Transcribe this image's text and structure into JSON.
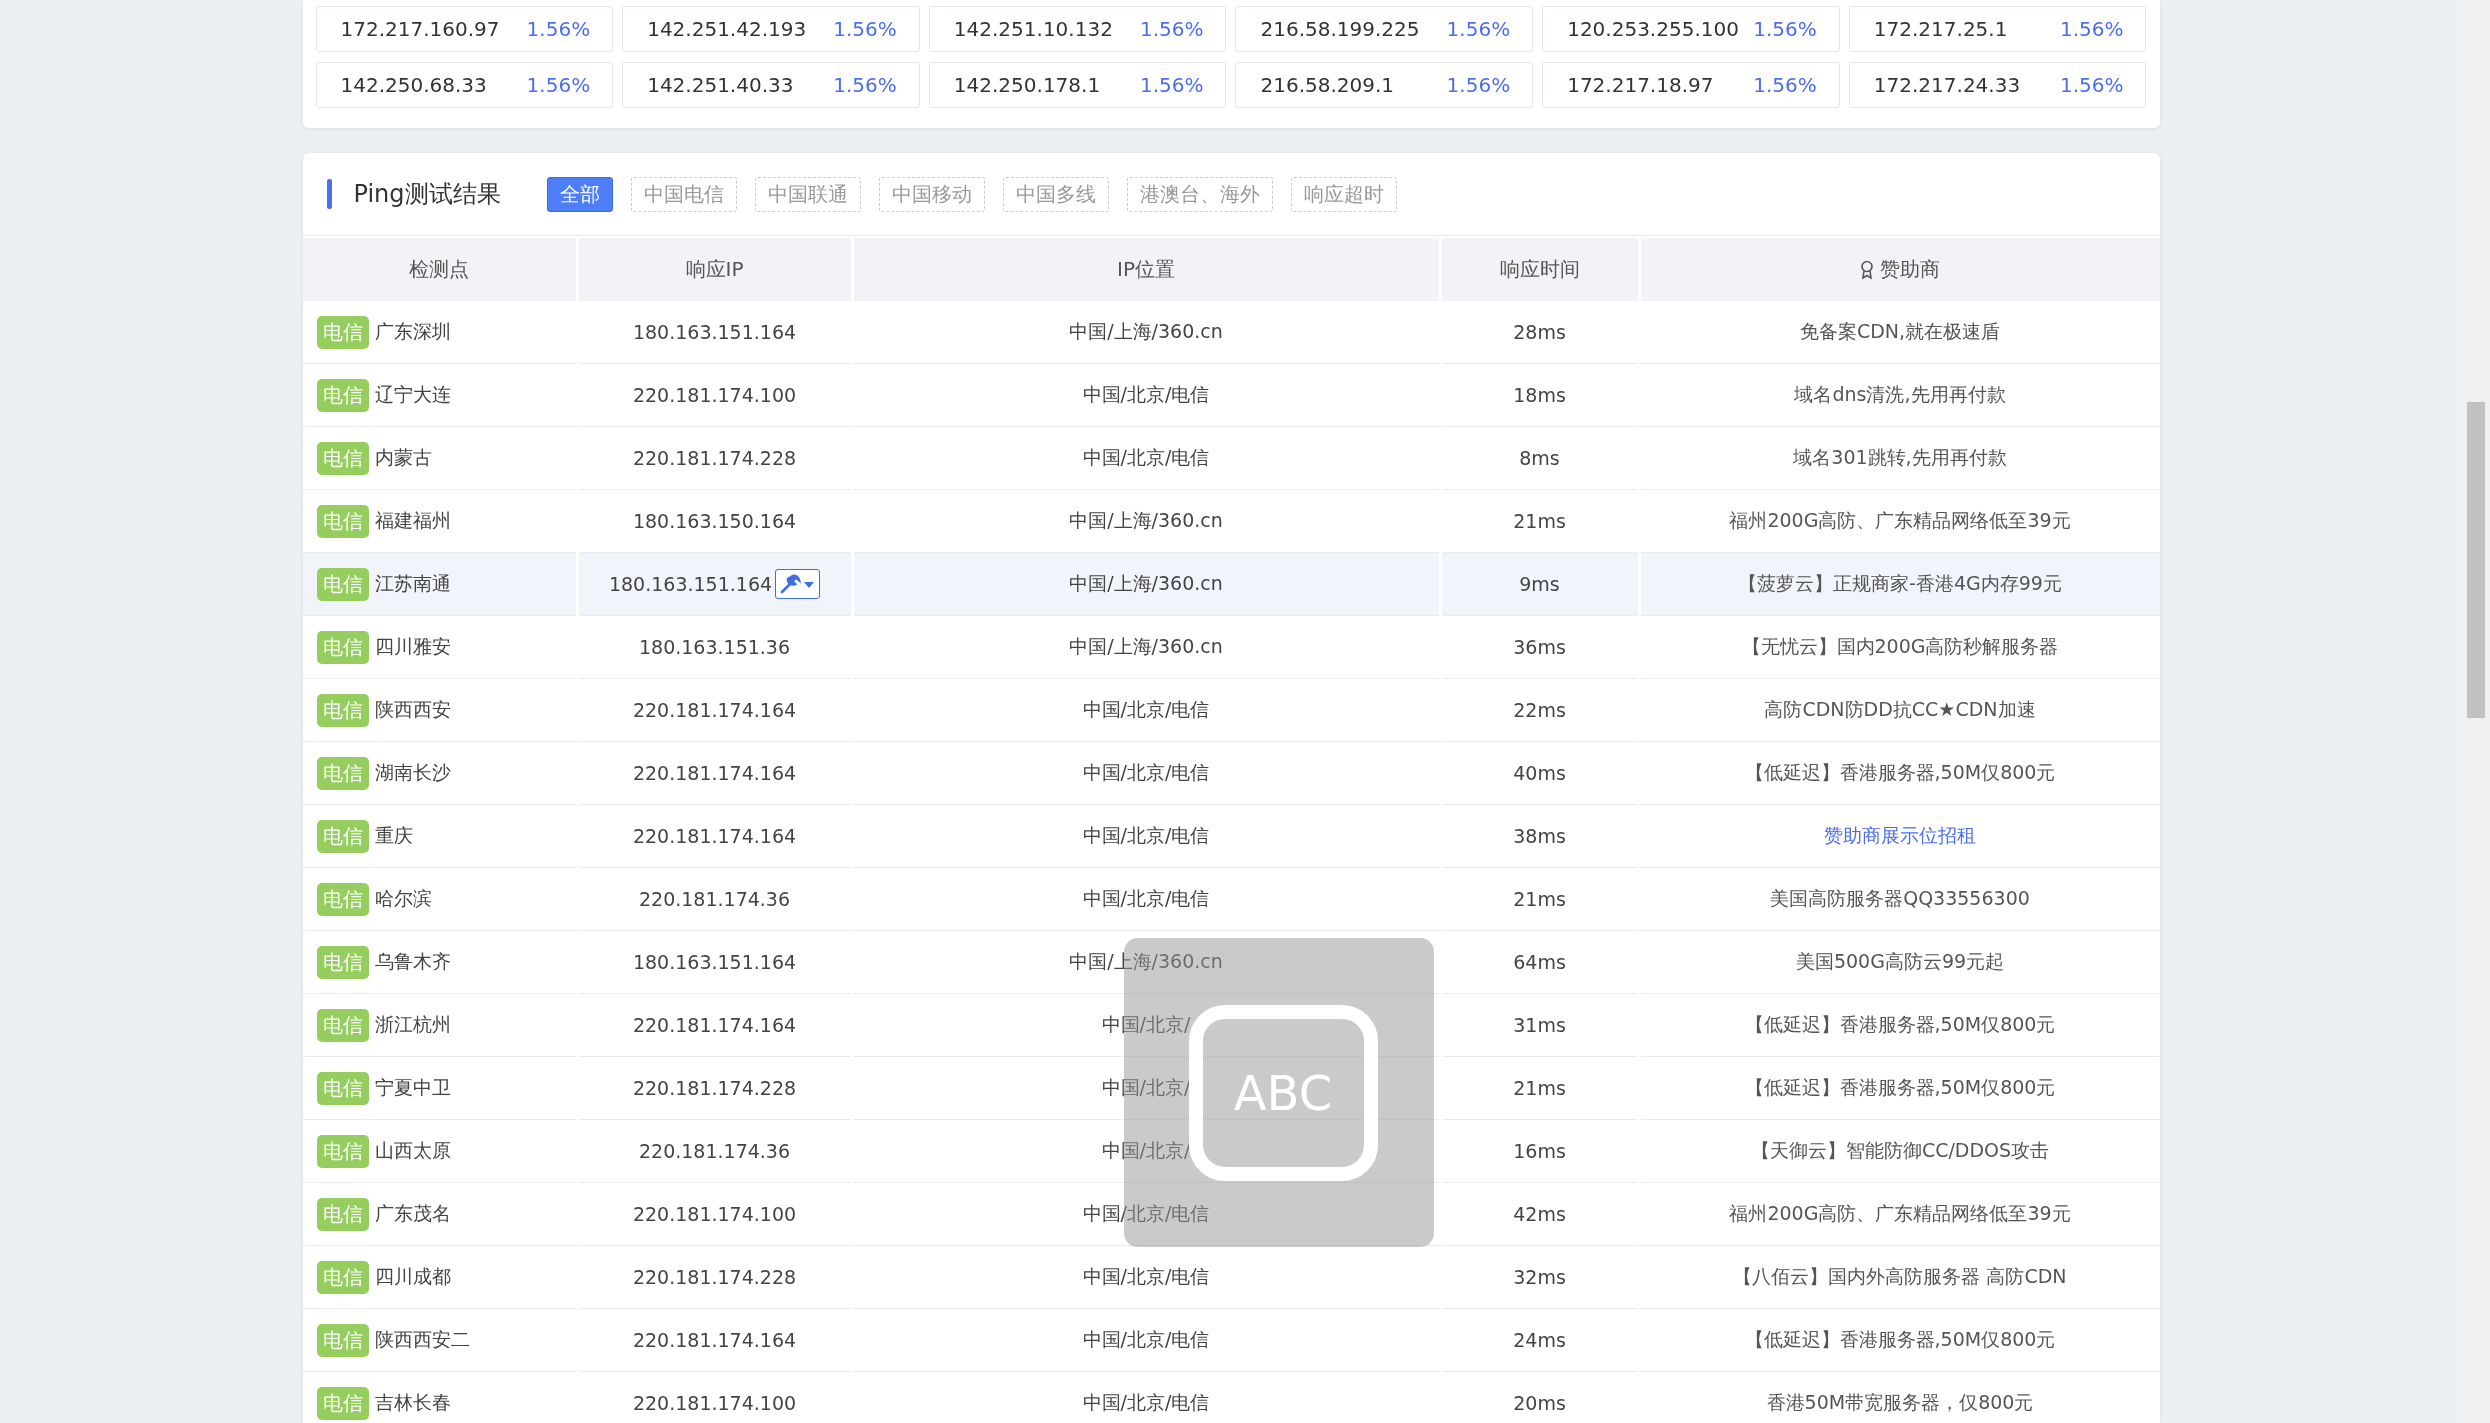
{
  "ip_stats": [
    {
      "ip": "172.217.160.97",
      "share": "1.56%"
    },
    {
      "ip": "142.251.42.193",
      "share": "1.56%"
    },
    {
      "ip": "142.251.10.132",
      "share": "1.56%"
    },
    {
      "ip": "216.58.199.225",
      "share": "1.56%"
    },
    {
      "ip": "120.253.255.100",
      "share": "1.56%"
    },
    {
      "ip": "172.217.25.1",
      "share": "1.56%"
    },
    {
      "ip": "142.250.68.33",
      "share": "1.56%"
    },
    {
      "ip": "142.251.40.33",
      "share": "1.56%"
    },
    {
      "ip": "142.250.178.1",
      "share": "1.56%"
    },
    {
      "ip": "216.58.209.1",
      "share": "1.56%"
    },
    {
      "ip": "172.217.18.97",
      "share": "1.56%"
    },
    {
      "ip": "172.217.24.33",
      "share": "1.56%"
    }
  ],
  "ping_panel": {
    "title": "Ping测试结果",
    "filters": [
      {
        "label": "全部",
        "selected": true
      },
      {
        "label": "中国电信",
        "selected": false
      },
      {
        "label": "中国联通",
        "selected": false
      },
      {
        "label": "中国移动",
        "selected": false
      },
      {
        "label": "中国多线",
        "selected": false
      },
      {
        "label": "港澳台、海外",
        "selected": false
      },
      {
        "label": "响应超时",
        "selected": false
      }
    ],
    "columns": [
      "检测点",
      "响应IP",
      "IP位置",
      "响应时间",
      "赞助商"
    ],
    "rows": [
      {
        "isp": "电信",
        "node": "广东深圳",
        "ip": "180.163.151.164",
        "location": "中国/上海/360.cn",
        "time": "28ms",
        "sponsor": "免备案CDN,就在极速盾",
        "sponsor_link": false,
        "highlighted": false,
        "tool_menu": false
      },
      {
        "isp": "电信",
        "node": "辽宁大连",
        "ip": "220.181.174.100",
        "location": "中国/北京/电信",
        "time": "18ms",
        "sponsor": "域名dns清洗,先用再付款",
        "sponsor_link": false,
        "highlighted": false,
        "tool_menu": false
      },
      {
        "isp": "电信",
        "node": "内蒙古",
        "ip": "220.181.174.228",
        "location": "中国/北京/电信",
        "time": "8ms",
        "sponsor": "域名301跳转,先用再付款",
        "sponsor_link": false,
        "highlighted": false,
        "tool_menu": false
      },
      {
        "isp": "电信",
        "node": "福建福州",
        "ip": "180.163.150.164",
        "location": "中国/上海/360.cn",
        "time": "21ms",
        "sponsor": "福州200G高防、广东精品网络低至39元",
        "sponsor_link": false,
        "highlighted": false,
        "tool_menu": false
      },
      {
        "isp": "电信",
        "node": "江苏南通",
        "ip": "180.163.151.164",
        "location": "中国/上海/360.cn",
        "time": "9ms",
        "sponsor": "【菠萝云】正规商家-香港4G内存99元",
        "sponsor_link": false,
        "highlighted": true,
        "tool_menu": true
      },
      {
        "isp": "电信",
        "node": "四川雅安",
        "ip": "180.163.151.36",
        "location": "中国/上海/360.cn",
        "time": "36ms",
        "sponsor": "【无忧云】国内200G高防秒解服务器",
        "sponsor_link": false,
        "highlighted": false,
        "tool_menu": false
      },
      {
        "isp": "电信",
        "node": "陕西西安",
        "ip": "220.181.174.164",
        "location": "中国/北京/电信",
        "time": "22ms",
        "sponsor": "高防CDN防DD抗CC★CDN加速",
        "sponsor_link": false,
        "highlighted": false,
        "tool_menu": false
      },
      {
        "isp": "电信",
        "node": "湖南长沙",
        "ip": "220.181.174.164",
        "location": "中国/北京/电信",
        "time": "40ms",
        "sponsor": "【低延迟】香港服务器,50M仅800元",
        "sponsor_link": false,
        "highlighted": false,
        "tool_menu": false
      },
      {
        "isp": "电信",
        "node": "重庆",
        "ip": "220.181.174.164",
        "location": "中国/北京/电信",
        "time": "38ms",
        "sponsor": "赞助商展示位招租",
        "sponsor_link": true,
        "highlighted": false,
        "tool_menu": false
      },
      {
        "isp": "电信",
        "node": "哈尔滨",
        "ip": "220.181.174.36",
        "location": "中国/北京/电信",
        "time": "21ms",
        "sponsor": "美国高防服务器QQ33556300",
        "sponsor_link": false,
        "highlighted": false,
        "tool_menu": false
      },
      {
        "isp": "电信",
        "node": "乌鲁木齐",
        "ip": "180.163.151.164",
        "location": "中国/上海/360.cn",
        "time": "64ms",
        "sponsor": "美国500G高防云99元起",
        "sponsor_link": false,
        "highlighted": false,
        "tool_menu": false
      },
      {
        "isp": "电信",
        "node": "浙江杭州",
        "ip": "220.181.174.164",
        "location": "中国/北京/",
        "time": "31ms",
        "sponsor": "【低延迟】香港服务器,50M仅800元",
        "sponsor_link": false,
        "highlighted": false,
        "tool_menu": false
      },
      {
        "isp": "电信",
        "node": "宁夏中卫",
        "ip": "220.181.174.228",
        "location": "中国/北京/",
        "time": "21ms",
        "sponsor": "【低延迟】香港服务器,50M仅800元",
        "sponsor_link": false,
        "highlighted": false,
        "tool_menu": false
      },
      {
        "isp": "电信",
        "node": "山西太原",
        "ip": "220.181.174.36",
        "location": "中国/北京/",
        "time": "16ms",
        "sponsor": "【天御云】智能防御CC/DDOS攻击",
        "sponsor_link": false,
        "highlighted": false,
        "tool_menu": false
      },
      {
        "isp": "电信",
        "node": "广东茂名",
        "ip": "220.181.174.100",
        "location": "中国/北京/电信",
        "time": "42ms",
        "sponsor": "福州200G高防、广东精品网络低至39元",
        "sponsor_link": false,
        "highlighted": false,
        "tool_menu": false
      },
      {
        "isp": "电信",
        "node": "四川成都",
        "ip": "220.181.174.228",
        "location": "中国/北京/电信",
        "time": "32ms",
        "sponsor": "【八佰云】国内外高防服务器 高防CDN",
        "sponsor_link": false,
        "highlighted": false,
        "tool_menu": false
      },
      {
        "isp": "电信",
        "node": "陕西西安二",
        "ip": "220.181.174.164",
        "location": "中国/北京/电信",
        "time": "24ms",
        "sponsor": "【低延迟】香港服务器,50M仅800元",
        "sponsor_link": false,
        "highlighted": false,
        "tool_menu": false
      },
      {
        "isp": "电信",
        "node": "吉林长春",
        "ip": "220.181.174.100",
        "location": "中国/北京/电信",
        "time": "20ms",
        "sponsor": "香港50M带宽服务器，仅800元",
        "sponsor_link": false,
        "highlighted": false,
        "tool_menu": false
      }
    ]
  },
  "ime_indicator": {
    "label": "ABC"
  }
}
